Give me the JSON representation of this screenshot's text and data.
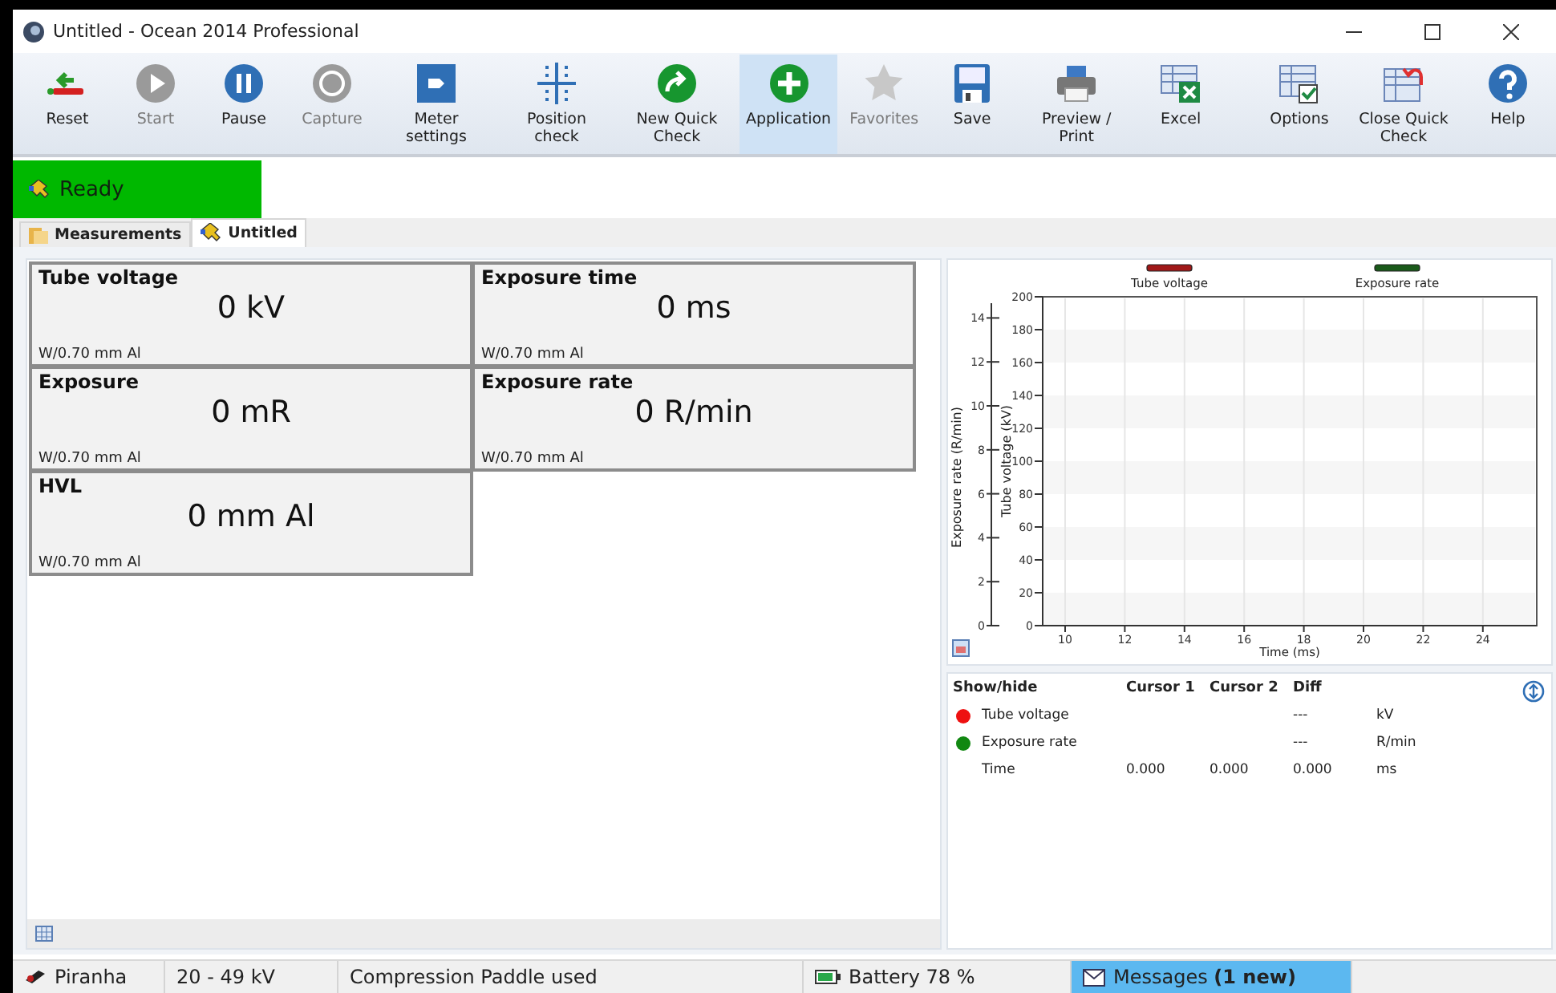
{
  "window": {
    "title": "Untitled - Ocean 2014 Professional"
  },
  "toolbar": {
    "groups": [
      [
        {
          "label": "Reset",
          "disabled": false,
          "selected": false
        },
        {
          "label": "Start",
          "disabled": true,
          "selected": false
        },
        {
          "label": "Pause",
          "disabled": false,
          "selected": false
        },
        {
          "label": "Capture",
          "disabled": true,
          "selected": false
        },
        {
          "label": "Meter settings",
          "disabled": false,
          "selected": false
        },
        {
          "label": "Position check",
          "disabled": false,
          "selected": false
        },
        {
          "label": "New Quick Check",
          "disabled": false,
          "selected": false
        },
        {
          "label": "Application",
          "disabled": false,
          "selected": true
        },
        {
          "label": "Favorites",
          "disabled": true,
          "selected": false
        },
        {
          "label": "Save",
          "disabled": false,
          "selected": false
        },
        {
          "label": "Preview / Print",
          "disabled": false,
          "selected": false
        },
        {
          "label": "Excel",
          "disabled": false,
          "selected": false
        }
      ],
      [
        {
          "label": "Options",
          "disabled": false,
          "selected": false
        },
        {
          "label": "Close Quick Check",
          "disabled": false,
          "selected": false
        },
        {
          "label": "Help",
          "disabled": false,
          "selected": false
        }
      ]
    ]
  },
  "status": {
    "label": "Ready"
  },
  "tabs": [
    {
      "label": "Measurements",
      "selected": false
    },
    {
      "label": "Untitled",
      "selected": true
    }
  ],
  "measurements": [
    {
      "title": "Tube voltage",
      "value": "0 kV",
      "filter": "W/0.70 mm Al"
    },
    {
      "title": "Exposure time",
      "value": "0 ms",
      "filter": "W/0.70 mm Al"
    },
    {
      "title": "Exposure",
      "value": "0 mR",
      "filter": "W/0.70 mm Al"
    },
    {
      "title": "Exposure rate",
      "value": "0 R/min",
      "filter": "W/0.70 mm Al"
    },
    {
      "title": "HVL",
      "value": "0 mm Al",
      "filter": "W/0.70 mm Al"
    }
  ],
  "chart": {
    "chart_data": {
      "type": "line",
      "xlabel": "Time (ms)",
      "ylabel": "Tube voltage (kV)",
      "categories": [
        "10",
        "12",
        "14",
        "16",
        "18",
        "20",
        "22",
        "24"
      ],
      "ylim": [
        0,
        200
      ],
      "grid": true,
      "yticks": [
        0,
        20,
        40,
        60,
        80,
        100,
        120,
        140,
        160,
        180,
        200
      ],
      "series": [
        {
          "name": "Tube voltage",
          "color": "#a01818",
          "values": [
            null,
            null,
            null,
            null,
            null,
            null,
            null,
            null
          ]
        },
        {
          "name": "Exposure rate",
          "color": "#1a5a1a",
          "values": [
            null,
            null,
            null,
            null,
            null,
            null,
            null,
            null
          ]
        }
      ]
    },
    "secondary_axis": {
      "title": "Exposure rate (R/min)",
      "ticks": [
        "14",
        "12",
        "10",
        "8",
        "6",
        "4",
        "2",
        "0"
      ]
    }
  },
  "cursor_table": {
    "columns": [
      "Show/hide",
      "Cursor 1",
      "Cursor 2",
      "Diff"
    ],
    "rows": [
      {
        "name": "Tube voltage",
        "color": "#ee1111",
        "diff": "---",
        "unit": "kV"
      },
      {
        "name": "Exposure rate",
        "color": "#118811",
        "diff": "---",
        "unit": "R/min"
      },
      {
        "name": "Time",
        "cursor_1": "0.000",
        "cursor_2": "0.000",
        "diff": "0.000",
        "unit": "ms"
      }
    ]
  },
  "status_bar": [
    {
      "kind": "device",
      "text": "Piranha"
    },
    {
      "kind": "text",
      "text": "20 - 49 kV"
    },
    {
      "kind": "text",
      "text": "Compression Paddle used"
    },
    {
      "kind": "battery",
      "text": "Battery 78 %"
    },
    {
      "kind": "messages",
      "text": "Messages **(1 new)**",
      "highlighted": true
    }
  ]
}
